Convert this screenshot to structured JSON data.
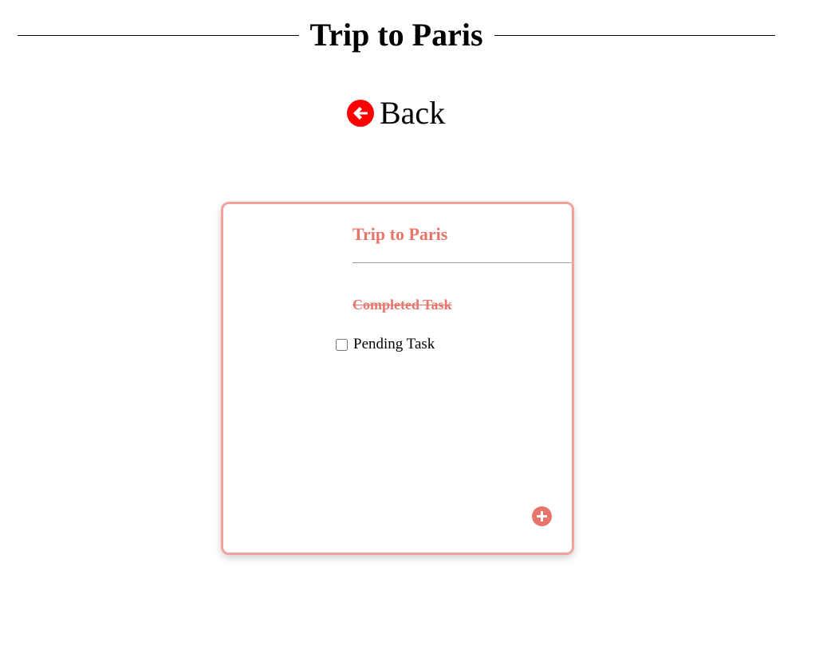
{
  "page": {
    "title": "Trip to Paris"
  },
  "back": {
    "label": "Back",
    "icon": "arrow-circle-left-icon",
    "icon_color": "#ff0000"
  },
  "card": {
    "title": "Trip to Paris",
    "border_color": "#f4a19b",
    "accent_color": "#e8756c",
    "tasks": [
      {
        "label": "Completed Task",
        "completed": true
      },
      {
        "label": "Pending Task",
        "completed": false
      }
    ],
    "add_icon": "plus-circle-icon"
  }
}
